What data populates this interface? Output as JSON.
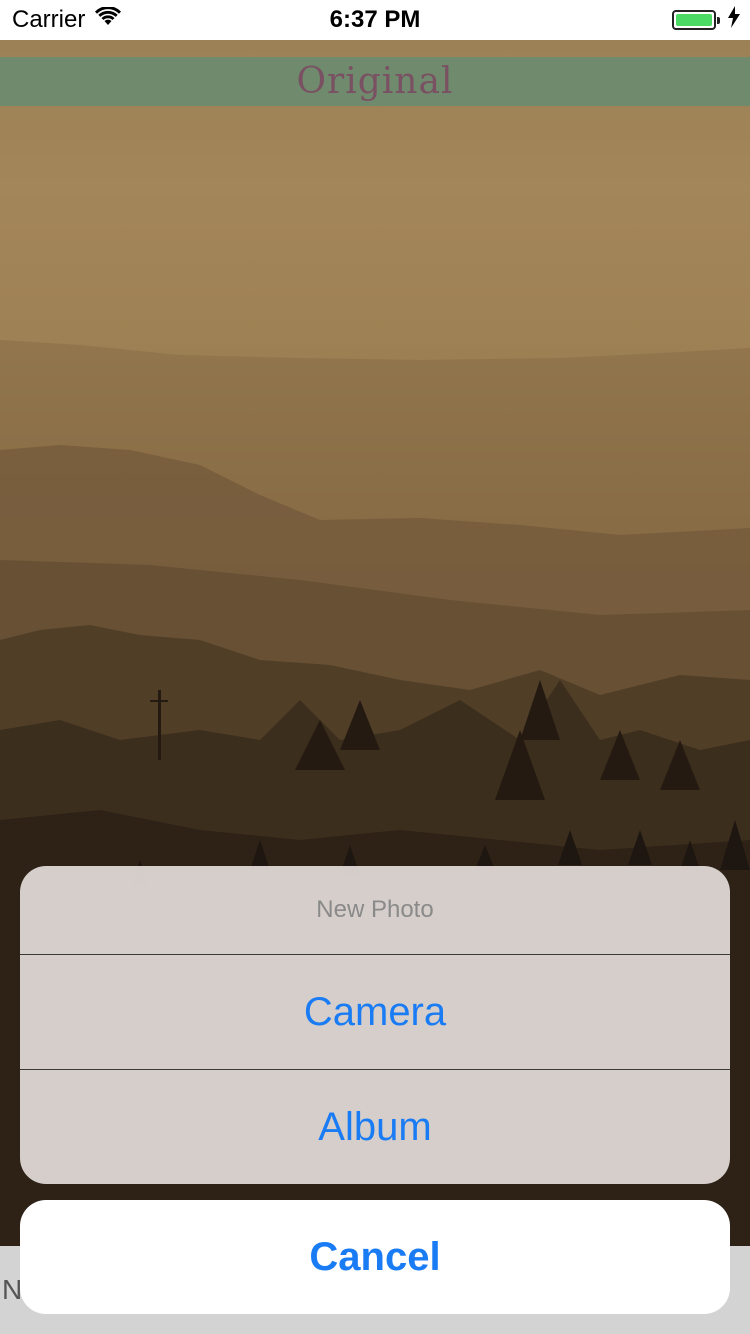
{
  "status_bar": {
    "carrier": "Carrier",
    "time": "6:37 PM",
    "wifi_icon": "wifi-icon",
    "battery_icon": "battery-icon",
    "charging_icon": "bolt-icon",
    "battery_color": "#4cd964"
  },
  "header": {
    "title": "Original",
    "band_color": "#6f8a6c",
    "title_color": "#7a5163"
  },
  "bottom_bar": {
    "visible_text": "N"
  },
  "action_sheet": {
    "title": "New Photo",
    "options": [
      {
        "label": "Camera"
      },
      {
        "label": "Album"
      }
    ],
    "cancel_label": "Cancel",
    "accent_color": "#1a7cf4"
  }
}
